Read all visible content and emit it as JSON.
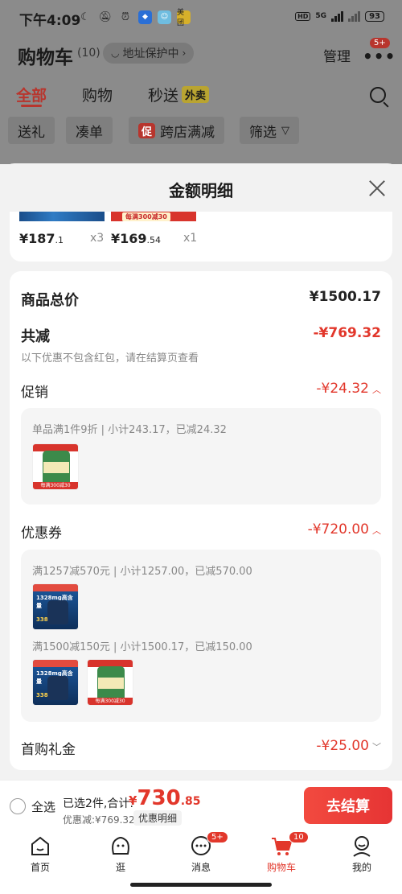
{
  "status_bar": {
    "time": "下午4:09",
    "network": "5G",
    "battery": "93",
    "hd": "HD",
    "app_badge": "美团"
  },
  "header": {
    "title": "购物车",
    "count": "(10)",
    "address_protect": "地址保护中",
    "manage": "管理",
    "more_badge": "5+"
  },
  "tabs": {
    "all": "全部",
    "shopping": "购物",
    "flash": "秒送",
    "waimai": "外卖"
  },
  "filters": {
    "gift": "送礼",
    "bundle": "凑单",
    "cu": "促",
    "cross_store": "跨店满减",
    "filter": "筛选"
  },
  "sheet": {
    "title": "金额明细",
    "top_items": [
      {
        "price_int": "¥187",
        "price_dec": ".1",
        "qty": "x3"
      },
      {
        "price_int": "¥169",
        "price_dec": ".54",
        "qty": "x1",
        "banner": "每满300减30"
      }
    ],
    "total_label": "商品总价",
    "total_value": "¥1500.17",
    "reduce_label": "共减",
    "reduce_value": "-¥769.32",
    "reduce_note": "以下优惠不包含红包，请在结算页查看",
    "promo": {
      "label": "促销",
      "value": "-¥24.32",
      "line": "单品满1件9折 | 小计243.17，已减24.32",
      "product_banner": "每满300减30"
    },
    "coupon": {
      "label": "优惠券",
      "value": "-¥720.00",
      "line1": "满1257减570元 | 小计1257.00，已减570.00",
      "line2": "满1500减150元 | 小计1500.17，已减150.00",
      "product_tag": "1328mg高含量",
      "product_price": "338",
      "product_banner": "每满300减30"
    },
    "first_gift": {
      "label": "首购礼金",
      "value": "-¥25.00"
    }
  },
  "checkout": {
    "select_all": "全选",
    "selected": "已选2件,合计:",
    "currency": "¥",
    "total_int": "730",
    "total_dec": ".85",
    "discount": "优惠减:¥769.32",
    "detail": "优惠明细",
    "pay": "去结算"
  },
  "nav": {
    "items": [
      {
        "label": "首页"
      },
      {
        "label": "逛"
      },
      {
        "label": "消息",
        "badge": "5+"
      },
      {
        "label": "购物车",
        "badge": "10"
      },
      {
        "label": "我的"
      }
    ]
  },
  "colors": {
    "accent": "#e2372b",
    "dim": "#8b8b8b"
  }
}
